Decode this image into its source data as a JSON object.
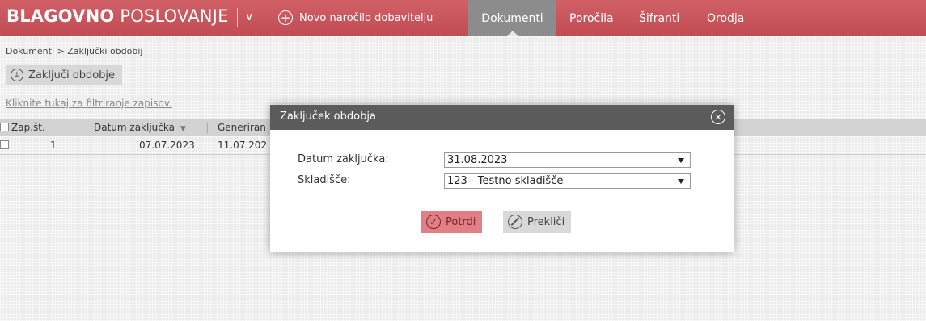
{
  "header": {
    "brand_bold": "BLAGOVNO",
    "brand_thin": "POSLOVANJE",
    "new_order_label": "Novo naročilo dobavitelju",
    "nav": [
      {
        "label": "Dokumenti",
        "active": true
      },
      {
        "label": "Poročila",
        "active": false
      },
      {
        "label": "Šifranti",
        "active": false
      },
      {
        "label": "Orodja",
        "active": false
      }
    ]
  },
  "breadcrumb": "Dokumenti > Zaključki obdobij",
  "toolbar": {
    "close_period_label": "Zaključi obdobje"
  },
  "filter_link": "Kliknite tukaj za filtriranje zapisov.",
  "table": {
    "columns": [
      "Zap.št.",
      "Datum zaključka",
      "Generiran"
    ],
    "rows": [
      {
        "num": "1",
        "date": "07.07.2023",
        "generated": "11.07.202"
      }
    ]
  },
  "modal": {
    "title": "Zaključek obdobja",
    "date_label": "Datum zaključka:",
    "date_value": "31.08.2023",
    "warehouse_label": "Skladišče:",
    "warehouse_value": "123 - Testno skladišče",
    "confirm_label": "Potrdi",
    "cancel_label": "Prekliči"
  },
  "colors": {
    "header_bg": "#c9545b",
    "nav_active_bg": "#8c8c8c",
    "modal_header_bg": "#5b5b5b",
    "confirm_bg": "#e07f85"
  }
}
